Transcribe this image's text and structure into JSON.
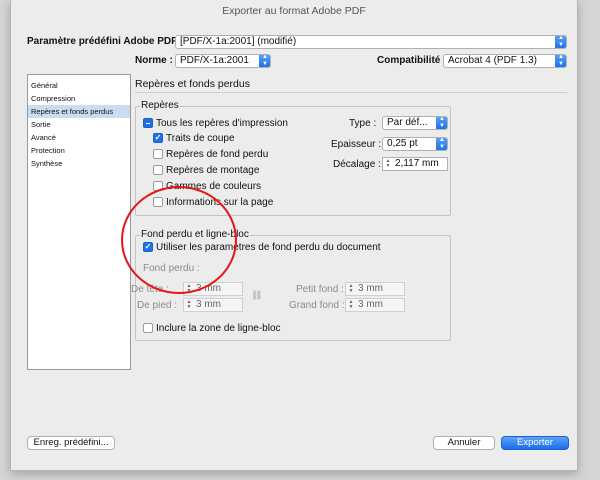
{
  "window": {
    "title": "Exporter au format Adobe PDF"
  },
  "header": {
    "preset_label": "Paramètre prédéfini Adobe PDF :",
    "preset_value": "[PDF/X-1a:2001] (modifié)",
    "norme_label": "Norme :",
    "norme_value": "PDF/X-1a:2001",
    "compat_label": "Compatibilité :",
    "compat_value": "Acrobat 4 (PDF 1.3)"
  },
  "sidebar": {
    "items": [
      {
        "label": "Général"
      },
      {
        "label": "Compression"
      },
      {
        "label": "Repères et fonds perdus"
      },
      {
        "label": "Sortie"
      },
      {
        "label": "Avancé"
      },
      {
        "label": "Protection"
      },
      {
        "label": "Synthèse"
      }
    ]
  },
  "section": {
    "title": "Repères et fonds perdus"
  },
  "reperes": {
    "title": "Repères",
    "all_label": "Tous les repères d'impression",
    "traits_label": "Traits de coupe",
    "fond_label": "Repères de fond perdu",
    "montage_label": "Repères de montage",
    "gammes_label": "Gammes de couleurs",
    "info_label": "Informations sur la page",
    "type_label": "Type :",
    "type_value": "Par déf...",
    "epaisseur_label": "Epaisseur :",
    "epaisseur_value": "0,25 pt",
    "decalage_label": "Décalage :",
    "decalage_value": "2,117 mm"
  },
  "fond": {
    "title": "Fond perdu et ligne-bloc",
    "use_doc_label": "Utiliser les paramètres de fond perdu du document",
    "fond_perdu_label": "Fond perdu :",
    "tete_label": "De tête :",
    "tete_value": "3 mm",
    "pied_label": "De pied :",
    "pied_value": "3 mm",
    "petit_label": "Petit fond :",
    "petit_value": "3 mm",
    "grand_label": "Grand fond :",
    "grand_value": "3 mm",
    "ligne_bloc_label": "Inclure la zone de ligne-bloc"
  },
  "footer": {
    "save_preset": "Enreg. prédéfini...",
    "cancel": "Annuler",
    "export": "Exporter"
  },
  "colors": {
    "accent": "#1f72e6",
    "annotation": "#e4161b"
  }
}
